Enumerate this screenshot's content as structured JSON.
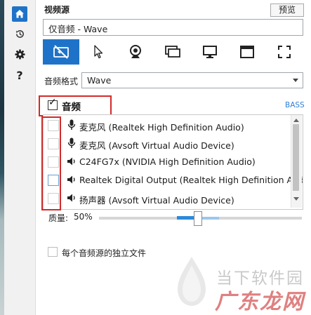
{
  "sidebar": {
    "items": [
      {
        "icon": "home-icon",
        "active": true
      },
      {
        "icon": "history-icon",
        "active": false
      },
      {
        "icon": "gear-icon",
        "active": false
      },
      {
        "icon": "help-icon",
        "label": "?",
        "active": false
      }
    ]
  },
  "header": {
    "title": "视频源",
    "preview_label": "预览"
  },
  "source": {
    "selected": "仅音频 - Wave"
  },
  "modes": [
    {
      "icon": "camera-off-icon",
      "active": true
    },
    {
      "icon": "cursor-icon",
      "active": false
    },
    {
      "icon": "webcam-icon",
      "active": false
    },
    {
      "icon": "screen-region-icon",
      "active": false
    },
    {
      "icon": "monitor-icon",
      "active": false
    },
    {
      "icon": "window-icon",
      "active": false
    },
    {
      "icon": "fullscreen-icon",
      "active": false
    }
  ],
  "audio_format": {
    "label": "音频格式",
    "value": "Wave"
  },
  "audio": {
    "title": "音频",
    "enabled": true,
    "bass_label": "BASS",
    "devices": [
      {
        "type": "microphone",
        "label": "麦克风 (Realtek High Definition Audio)",
        "checked": false
      },
      {
        "type": "microphone",
        "label": "麦克风 (Avsoft Virtual Audio Device)",
        "checked": false
      },
      {
        "type": "speaker",
        "label": "C24FG7x (NVIDIA High Definition Audio)",
        "checked": false
      },
      {
        "type": "speaker",
        "label": "Realtek Digital Output (Realtek High Definition Audio)",
        "checked": false
      },
      {
        "type": "speaker",
        "label": "扬声器 (Avsoft Virtual Audio Device)",
        "checked": false
      }
    ]
  },
  "quality": {
    "label": "质量:",
    "value_text": "50%",
    "value": 0.5
  },
  "separate_files": {
    "label": "每个音频源的独立文件",
    "checked": false
  },
  "watermark": {
    "top": "当下软件园",
    "bottom": "广东龙网"
  },
  "colors": {
    "accent": "#1e73c9",
    "highlight_box": "#d32a2a",
    "bass": "#2f7fd3"
  }
}
